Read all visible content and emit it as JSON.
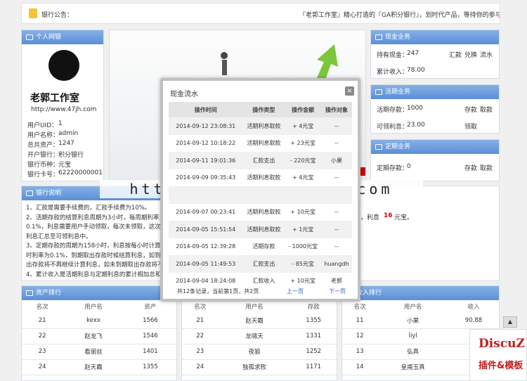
{
  "notice": {
    "label": "银行公告：",
    "text": "『老郭工作室』精心打造的『GA积分银行』，划时代产品，等待你的参与"
  },
  "personal": {
    "title": "个人网银",
    "logo_text": "老郭工作室",
    "site": "http://www.47jh.com",
    "fields": [
      {
        "label": "用户UID：",
        "value": "1"
      },
      {
        "label": "用户名称：",
        "value": "admin"
      },
      {
        "label": "总共资产：",
        "value": "1247"
      },
      {
        "label": "开户银行：",
        "value": "积分银行"
      },
      {
        "label": "银行币种：",
        "value": "元宝"
      },
      {
        "label": "银行卡号：",
        "value": "62220000001"
      }
    ]
  },
  "cash": {
    "title": "现金业务",
    "hold_label": "持有现金：",
    "hold_value": "247",
    "actions": [
      "汇款",
      "兑换",
      "流水"
    ],
    "income_label": "累计收入：",
    "income_value": "78.00"
  },
  "current": {
    "title": "活期业务",
    "deposit_label": "活期存款：",
    "deposit_value": "1000",
    "actions": [
      "存款",
      "取款"
    ],
    "interest_label": "可领利息：",
    "interest_value": "23.00",
    "claim": "领取"
  },
  "fixed": {
    "title": "定期业务",
    "deposit_label": "定期存款：",
    "deposit_value": "0",
    "actions": [
      "存款",
      "取款"
    ]
  },
  "explain": {
    "title": "银行说明",
    "lines": [
      "1、汇款是需要手续费的，汇款手续费为10%。",
      "2、活期存款的结算利息周期为3小时，每周期利率为",
      "0.1%，利息需要用户手动领取，每次未领取，这次未领",
      "利息汇总至可领利息中。",
      "3、定期存款的周期为158小时，利息按每小时计算，",
      "时利率为0.1%，到期取出存款时候结算利息，如到期",
      "出存款将不再继续计算利息，如未到期取出存款将不再",
      "4、累计收入是活期利息与定期利息的累计相加总和。"
    ],
    "right_prefix": "，利息",
    "right_value": "16",
    "right_unit": "元宝。"
  },
  "modal": {
    "title": "现金流水",
    "headers": [
      "操作时间",
      "操作类型",
      "操作金额",
      "操作对象"
    ],
    "rows": [
      [
        "2014-09-12 23:08:31",
        "活期利息取款",
        "+ 4元宝",
        "--"
      ],
      [
        "2014-09-12 10:18:22",
        "活期利息取款",
        "+ 23元宝",
        "--"
      ],
      [
        "2014-09-11 19:01:36",
        "汇款支出",
        "- 220元宝",
        "小果"
      ],
      [
        "2014-09-09 09:35:43",
        "活期利息取款",
        "+ 4元宝",
        "--"
      ],
      [
        "",
        "",
        "",
        ""
      ],
      [
        "2014-09-07 00:23:41",
        "活期利息取款",
        "+ 10元宝",
        "--"
      ],
      [
        "2014-09-05 15:51:54",
        "活期利息取款",
        "+ 1元宝",
        "--"
      ],
      [
        "2014-09-05 12:39:28",
        "活期存款",
        "- 1000元宝",
        "--"
      ],
      [
        "2014-09-05 11:49:53",
        "汇款支出",
        "- 85元宝",
        "huangdh"
      ],
      [
        "2014-09-04 18:24:08",
        "汇款收入",
        "+ 10元宝",
        "老郭"
      ]
    ],
    "summary": "共12条记录，当前第1页，共2页",
    "prev": "上一页",
    "next": "下一页"
  },
  "watermark": "https://www.songma.com",
  "rank_assets": {
    "title": "资产排行",
    "headers": [
      "名次",
      "用户名",
      "资产"
    ],
    "rows": [
      [
        "21",
        "kexx",
        "1566"
      ],
      [
        "22",
        "赵龙飞",
        "1546"
      ],
      [
        "23",
        "看丽丝",
        "1401"
      ],
      [
        "24",
        "赵天霸",
        "1355"
      ]
    ]
  },
  "rank_deposit": {
    "headers": [
      "名次",
      "用户名",
      "存款"
    ],
    "rows": [
      [
        "21",
        "赵天霸",
        "1355"
      ],
      [
        "22",
        "龙啸天",
        "1331"
      ],
      [
        "23",
        "夜狼",
        "1252"
      ],
      [
        "24",
        "独孤求败",
        "1171"
      ]
    ]
  },
  "rank_income": {
    "title": "收入排行",
    "headers": [
      "名次",
      "用户名",
      "收入"
    ],
    "rows": [
      [
        "11",
        "小果",
        "90.88"
      ],
      [
        "12",
        "liyl",
        ""
      ],
      [
        "13",
        "弘真",
        ""
      ],
      [
        "14",
        "皇甫玉真",
        ""
      ]
    ]
  },
  "badge": {
    "line1": "DiscuZ",
    "line2": "插件&模板"
  }
}
